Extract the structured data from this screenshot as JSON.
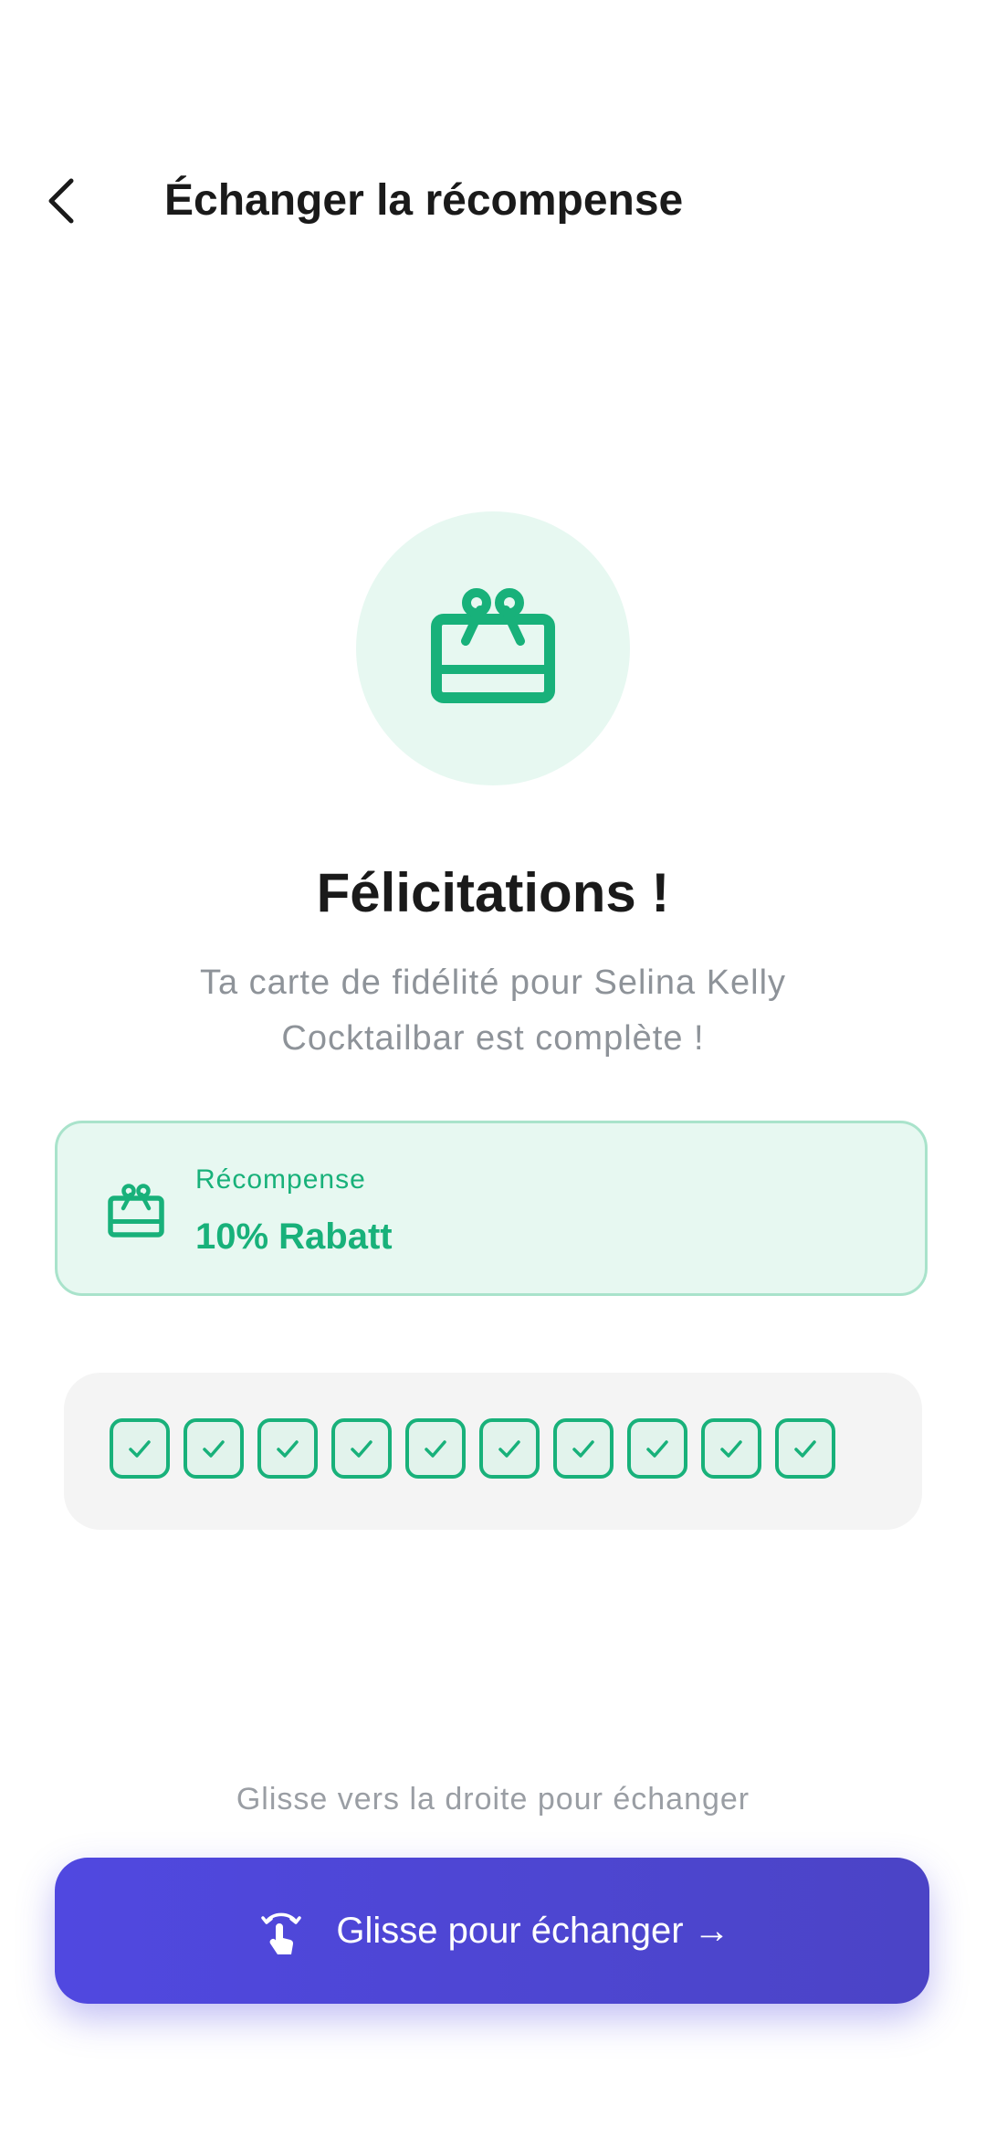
{
  "header": {
    "title": "Échanger la récompense",
    "back_icon": "chevron-left-icon"
  },
  "hero": {
    "icon": "gift-card-icon",
    "title": "Félicitations !",
    "message": "Ta carte de fidélité pour Selina Kelly Cocktailbar est complète !"
  },
  "reward": {
    "icon": "gift-card-icon",
    "label": "Récompense",
    "value": "10% Rabatt"
  },
  "stamps": {
    "total": 10,
    "filled": 10,
    "icon": "check-icon"
  },
  "swipe": {
    "hint": "Glisse vers la droite pour échanger",
    "label": "Glisse pour échanger →",
    "icon": "swipe-gesture-icon"
  },
  "colors": {
    "accent_green": "#18B17A",
    "green_bg": "#E7F8F1",
    "button_purple": "#5048E0",
    "muted_text": "#8E9399"
  }
}
